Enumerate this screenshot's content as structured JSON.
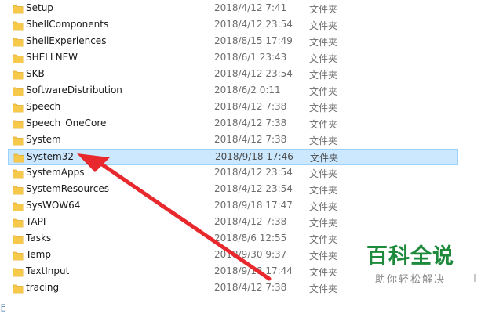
{
  "files": [
    {
      "name": "Setup",
      "date": "2018/4/12 7:41",
      "type": "文件夹"
    },
    {
      "name": "ShellComponents",
      "date": "2018/4/12 23:54",
      "type": "文件夹"
    },
    {
      "name": "ShellExperiences",
      "date": "2018/8/15 17:49",
      "type": "文件夹"
    },
    {
      "name": "SHELLNEW",
      "date": "2018/6/1 23:43",
      "type": "文件夹"
    },
    {
      "name": "SKB",
      "date": "2018/4/12 23:54",
      "type": "文件夹"
    },
    {
      "name": "SoftwareDistribution",
      "date": "2018/6/2 0:11",
      "type": "文件夹"
    },
    {
      "name": "Speech",
      "date": "2018/4/12 7:38",
      "type": "文件夹"
    },
    {
      "name": "Speech_OneCore",
      "date": "2018/4/12 7:38",
      "type": "文件夹"
    },
    {
      "name": "System",
      "date": "2018/4/12 7:38",
      "type": "文件夹"
    },
    {
      "name": "System32",
      "date": "2018/9/18 17:46",
      "type": "文件夹",
      "selected": true
    },
    {
      "name": "SystemApps",
      "date": "2018/4/12 23:54",
      "type": "文件夹"
    },
    {
      "name": "SystemResources",
      "date": "2018/4/12 23:54",
      "type": "文件夹"
    },
    {
      "name": "SysWOW64",
      "date": "2018/9/18 17:47",
      "type": "文件夹"
    },
    {
      "name": "TAPI",
      "date": "2018/4/12 7:38",
      "type": "文件夹"
    },
    {
      "name": "Tasks",
      "date": "2018/8/6 12:55",
      "type": "文件夹"
    },
    {
      "name": "Temp",
      "date": "2018/9/30 9:37",
      "type": "文件夹"
    },
    {
      "name": "TextInput",
      "date": "2018/9/18 17:44",
      "type": "文件夹"
    },
    {
      "name": "tracing",
      "date": "2018/4/12 7:38",
      "type": "文件夹"
    }
  ],
  "watermark": {
    "title": "百科全说",
    "subtitle": "助你轻松解决"
  },
  "edge_text": "目",
  "colors": {
    "folder": "#f7c94b",
    "folder_dark": "#e0a92a",
    "selection": "#cce8ff",
    "arrow": "#e8282d",
    "watermark": "#1e8a3c"
  },
  "icons": {
    "folder": "folder-icon"
  }
}
